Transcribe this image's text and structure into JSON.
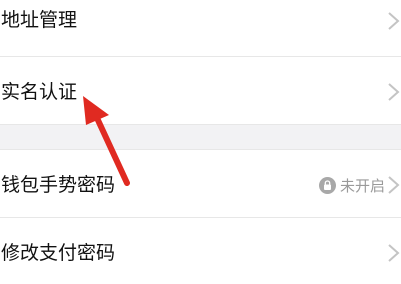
{
  "settings": {
    "items": [
      {
        "label": "地址管理"
      },
      {
        "label": "实名认证"
      },
      {
        "label": "钱包手势密码",
        "status": "未开启"
      },
      {
        "label": "修改支付密码"
      }
    ]
  },
  "icons": {
    "chevron": "chevron-right-icon",
    "lock": "lock-icon",
    "arrow": "red-arrow-annotation"
  },
  "colors": {
    "text": "#111111",
    "secondary_text": "#9a9a9a",
    "divider": "#e7e7e7",
    "section_gap": "#f2f2f4",
    "annotation_arrow": "#e02a21"
  }
}
